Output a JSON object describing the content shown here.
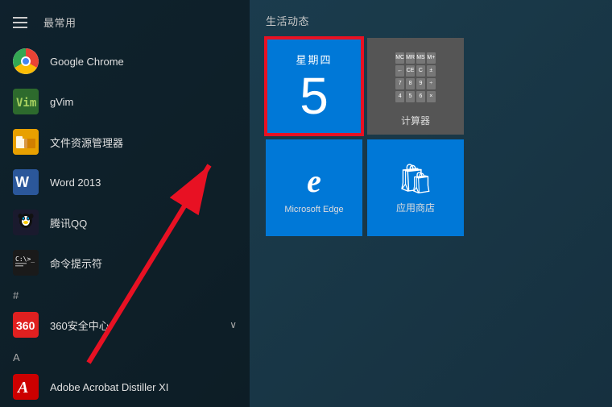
{
  "header": {
    "frequent_label": "最常用",
    "live_label": "生活动态"
  },
  "apps": [
    {
      "id": "chrome",
      "name": "Google Chrome",
      "icon_type": "chrome"
    },
    {
      "id": "gvim",
      "name": "gVim",
      "icon_type": "gvim"
    },
    {
      "id": "fileexp",
      "name": "文件资源管理器",
      "icon_type": "fileexp"
    },
    {
      "id": "word",
      "name": "Word 2013",
      "icon_type": "word"
    },
    {
      "id": "qq",
      "name": "腾讯QQ",
      "icon_type": "qq"
    },
    {
      "id": "cmd",
      "name": "命令提示符",
      "icon_type": "cmd"
    }
  ],
  "category_hash": "#",
  "app_360": {
    "name": "360安全中心",
    "icon_type": "360"
  },
  "category_a": "A",
  "app_acrobat": {
    "name": "Adobe Acrobat Distiller XI",
    "icon_type": "acrobat"
  },
  "tiles": {
    "calendar": {
      "day_name": "星期四",
      "day_num": "5"
    },
    "calculator": {
      "label": "计算器"
    },
    "edge": {
      "label": "Microsoft Edge"
    },
    "store": {
      "label": "应用商店"
    }
  }
}
